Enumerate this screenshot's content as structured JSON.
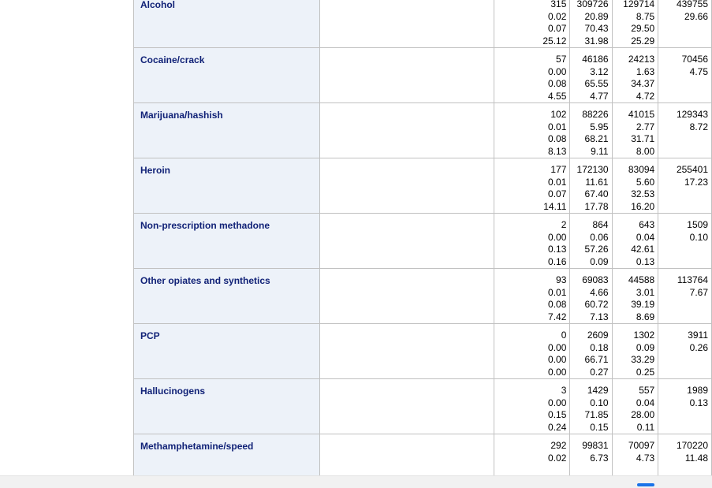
{
  "table": {
    "rows": [
      {
        "label": "Alcohol",
        "c_pre": "315",
        "c_pre_rest": [
          "0.02",
          "0.07",
          "25.12"
        ],
        "c_mid": [
          "309726",
          "20.89",
          "70.43",
          "31.98"
        ],
        "c_right": [
          "129714",
          "8.75",
          "29.50",
          "25.29"
        ],
        "total": [
          "439755",
          "29.66"
        ]
      },
      {
        "label": "Cocaine/crack",
        "c_pre": "57",
        "c_pre_rest": [
          "0.00",
          "0.08",
          "4.55"
        ],
        "c_mid": [
          "46186",
          "3.12",
          "65.55",
          "4.77"
        ],
        "c_right": [
          "24213",
          "1.63",
          "34.37",
          "4.72"
        ],
        "total": [
          "70456",
          "4.75"
        ]
      },
      {
        "label": "Marijuana/hashish",
        "c_pre": "102",
        "c_pre_rest": [
          "0.01",
          "0.08",
          "8.13"
        ],
        "c_mid": [
          "88226",
          "5.95",
          "68.21",
          "9.11"
        ],
        "c_right": [
          "41015",
          "2.77",
          "31.71",
          "8.00"
        ],
        "total": [
          "129343",
          "8.72"
        ]
      },
      {
        "label": "Heroin",
        "c_pre": "177",
        "c_pre_rest": [
          "0.01",
          "0.07",
          "14.11"
        ],
        "c_mid": [
          "172130",
          "11.61",
          "67.40",
          "17.78"
        ],
        "c_right": [
          "83094",
          "5.60",
          "32.53",
          "16.20"
        ],
        "total": [
          "255401",
          "17.23"
        ]
      },
      {
        "label": "Non-prescription methadone",
        "c_pre": "2",
        "c_pre_rest": [
          "0.00",
          "0.13",
          "0.16"
        ],
        "c_mid": [
          "864",
          "0.06",
          "57.26",
          "0.09"
        ],
        "c_right": [
          "643",
          "0.04",
          "42.61",
          "0.13"
        ],
        "total": [
          "1509",
          "0.10"
        ]
      },
      {
        "label": "Other opiates and synthetics",
        "c_pre": "93",
        "c_pre_rest": [
          "0.01",
          "0.08",
          "7.42"
        ],
        "c_mid": [
          "69083",
          "4.66",
          "60.72",
          "7.13"
        ],
        "c_right": [
          "44588",
          "3.01",
          "39.19",
          "8.69"
        ],
        "total": [
          "113764",
          "7.67"
        ]
      },
      {
        "label": "PCP",
        "c_pre": "0",
        "c_pre_rest": [
          "0.00",
          "0.00",
          "0.00"
        ],
        "c_mid": [
          "2609",
          "0.18",
          "66.71",
          "0.27"
        ],
        "c_right": [
          "1302",
          "0.09",
          "33.29",
          "0.25"
        ],
        "total": [
          "3911",
          "0.26"
        ]
      },
      {
        "label": "Hallucinogens",
        "c_pre": "3",
        "c_pre_rest": [
          "0.00",
          "0.15",
          "0.24"
        ],
        "c_mid": [
          "1429",
          "0.10",
          "71.85",
          "0.15"
        ],
        "c_right": [
          "557",
          "0.04",
          "28.00",
          "0.11"
        ],
        "total": [
          "1989",
          "0.13"
        ]
      },
      {
        "label": "Methamphetamine/speed",
        "c_pre": "292",
        "c_pre_rest": [
          "0.02"
        ],
        "c_mid": [
          "99831",
          "6.73"
        ],
        "c_right": [
          "70097",
          "4.73"
        ],
        "total": [
          "170220",
          "11.48"
        ]
      }
    ]
  },
  "colors": {
    "row_header_bg": "#edf2f9",
    "row_header_text": "#112277",
    "grid": "#c1c1c1"
  }
}
